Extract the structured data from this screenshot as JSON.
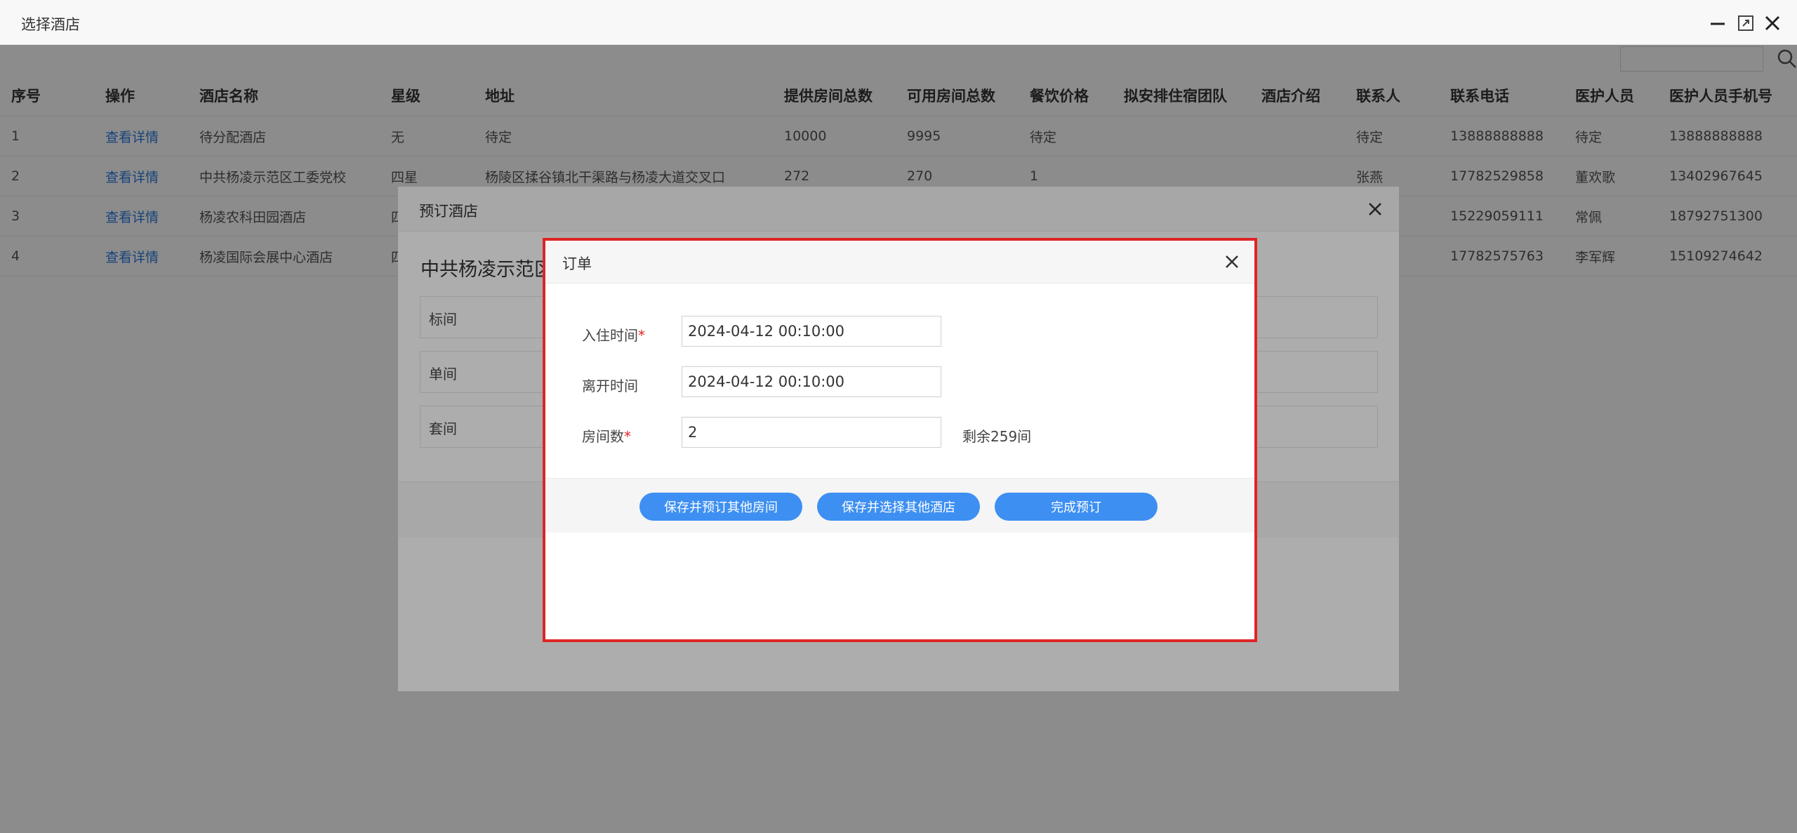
{
  "window": {
    "title": "选择酒店"
  },
  "table": {
    "headers": [
      "序号",
      "操作",
      "酒店名称",
      "星级",
      "地址",
      "提供房间总数",
      "可用房间总数",
      "餐饮价格",
      "拟安排住宿团队",
      "酒店介绍",
      "联系人",
      "联系电话",
      "医护人员",
      "医护人员手机号"
    ],
    "rows": [
      {
        "no": "1",
        "action": "查看详情",
        "name": "待分配酒店",
        "star": "无",
        "address": "待定",
        "total": "10000",
        "available": "9995",
        "price": "待定",
        "team": "",
        "intro": "",
        "contact": "待定",
        "phone": "13888888888",
        "medic": "待定",
        "medic_phone": "13888888888"
      },
      {
        "no": "2",
        "action": "查看详情",
        "name": "中共杨凌示范区工委党校",
        "star": "四星",
        "address": "杨陵区揉谷镇北干渠路与杨凌大道交叉口",
        "total": "272",
        "available": "270",
        "price": "1",
        "team": "",
        "intro": "",
        "contact": "张燕",
        "phone": "17782529858",
        "medic": "董欢歌",
        "medic_phone": "13402967645"
      },
      {
        "no": "3",
        "action": "查看详情",
        "name": "杨凌农科田园酒店",
        "star": "四",
        "address": "",
        "total": "",
        "available": "",
        "price": "",
        "team": "",
        "intro": "",
        "contact": "",
        "phone": "15229059111",
        "medic": "常佩",
        "medic_phone": "18792751300"
      },
      {
        "no": "4",
        "action": "查看详情",
        "name": "杨凌国际会展中心酒店",
        "star": "四",
        "address": "",
        "total": "",
        "available": "",
        "price": "",
        "team": "",
        "intro": "",
        "contact": "",
        "phone": "17782575763",
        "medic": "李军辉",
        "medic_phone": "15109274642"
      }
    ]
  },
  "booking_dialog": {
    "title": "预订酒店",
    "hotel_name": "中共杨凌示范区",
    "room_types": [
      "标间",
      "单间",
      "套间"
    ]
  },
  "order_dialog": {
    "title": "订单",
    "checkin_label": "入住时间",
    "checkin_value": "2024-04-12 00:10:00",
    "checkout_label": "离开时间",
    "checkout_value": "2024-04-12 00:10:00",
    "rooms_label": "房间数",
    "rooms_value": "2",
    "remaining_text": "剩余259间",
    "required_mark": "*",
    "buttons": {
      "save_book_other_rooms": "保存并预订其他房间",
      "save_choose_other_hotel": "保存并选择其他酒店",
      "finish": "完成预订"
    }
  }
}
